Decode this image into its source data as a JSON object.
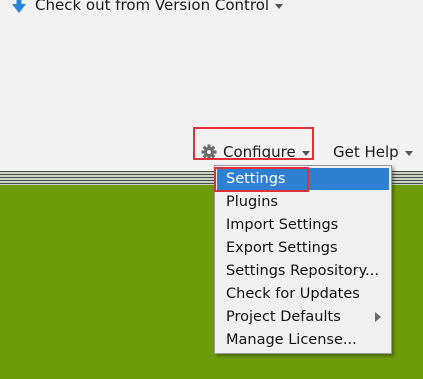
{
  "welcome": {
    "checkout_label": "Check out from Version Control",
    "configure_label": "Configure",
    "gethelp_label": "Get Help"
  },
  "configure_menu": {
    "items": [
      {
        "label": "Settings",
        "selected": true
      },
      {
        "label": "Plugins"
      },
      {
        "label": "Import Settings"
      },
      {
        "label": "Export Settings"
      },
      {
        "label": "Settings Repository..."
      },
      {
        "label": "Check for Updates"
      },
      {
        "label": "Project Defaults",
        "submenu": true
      },
      {
        "label": "Manage License..."
      }
    ]
  },
  "colors": {
    "menu_selection": "#2f80d2",
    "highlight_box": "#e0303a",
    "background_green": "#6e9b0a"
  },
  "icons": {
    "checkout": "arrow-down-icon",
    "configure": "gear-icon",
    "dropdown": "chevron-down-icon",
    "submenu": "chevron-right-icon"
  }
}
